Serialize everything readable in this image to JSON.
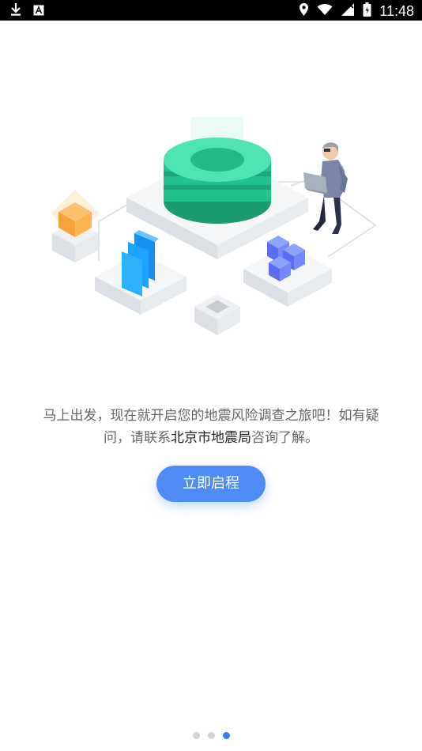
{
  "status_bar": {
    "time": "11:48",
    "icons": [
      "download-icon",
      "text-a-icon",
      "location-icon",
      "wifi-icon",
      "signal-icon",
      "battery-icon"
    ]
  },
  "onboarding": {
    "message_before": "马上出发，现在就开启您的地震风险调查之旅吧！如有疑问，请联系",
    "message_highlight": "北京市地震局",
    "message_after": "咨询了解。",
    "button_label": "立即启程",
    "page_count": 3,
    "active_page": 3
  },
  "colors": {
    "accent": "#4f8cf6",
    "active_dot": "#3c7cf2",
    "inactive_dot": "#d3d3d3",
    "highlight_text": "#222222"
  }
}
